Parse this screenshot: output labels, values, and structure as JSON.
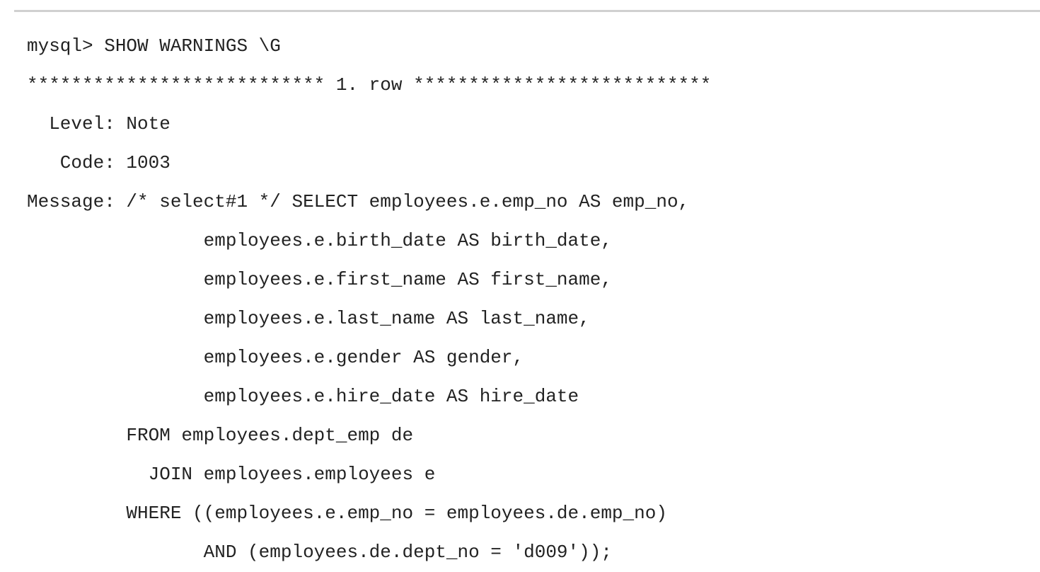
{
  "lines": [
    "mysql> SHOW WARNINGS \\G",
    "*************************** 1. row ***************************",
    "  Level: Note",
    "   Code: 1003",
    "Message: /* select#1 */ SELECT employees.e.emp_no AS emp_no,",
    "                employees.e.birth_date AS birth_date,",
    "                employees.e.first_name AS first_name,",
    "                employees.e.last_name AS last_name,",
    "                employees.e.gender AS gender,",
    "                employees.e.hire_date AS hire_date",
    "         FROM employees.dept_emp de",
    "           JOIN employees.employees e",
    "         WHERE ((employees.e.emp_no = employees.de.emp_no)",
    "                AND (employees.de.dept_no = 'd009'));"
  ]
}
